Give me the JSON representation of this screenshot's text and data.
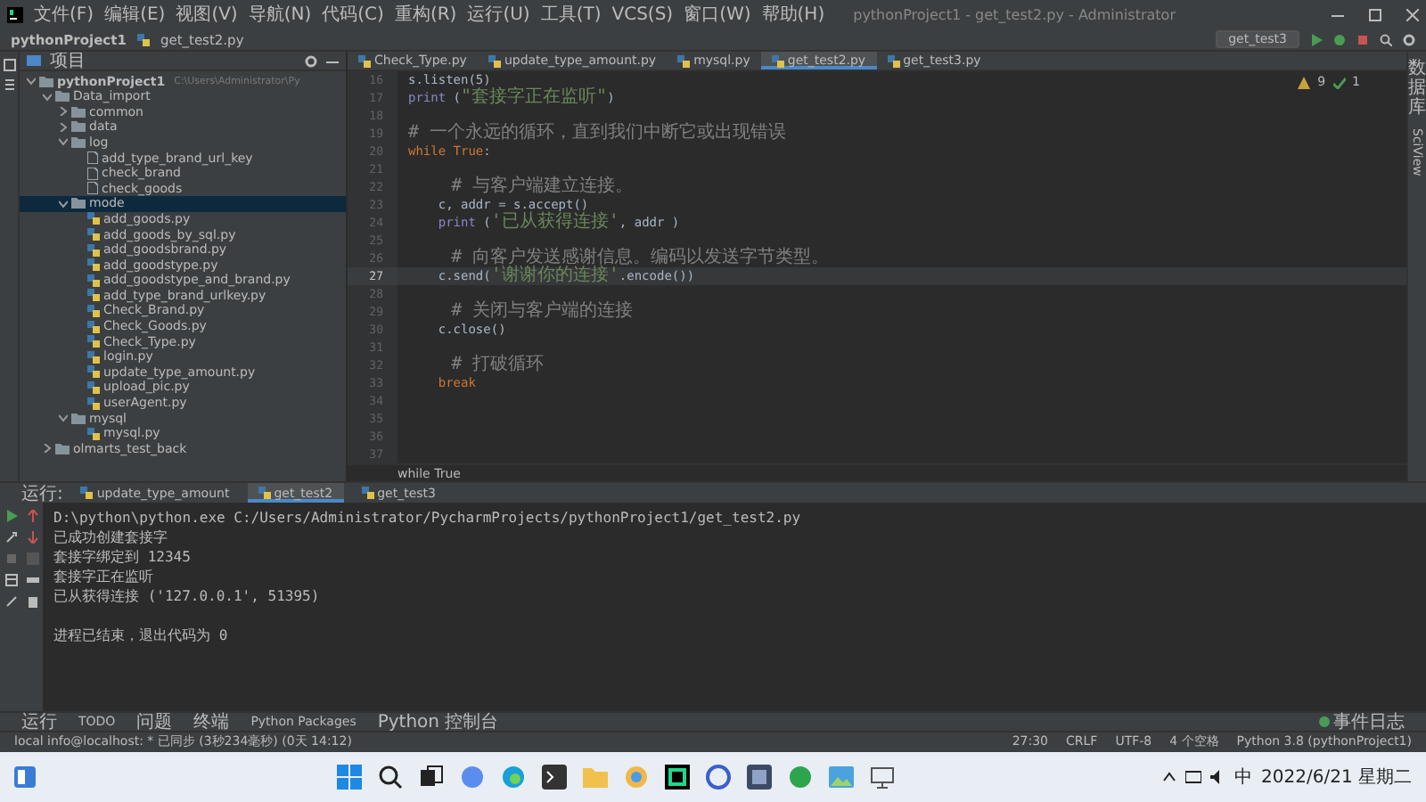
{
  "title_bar": {
    "menus": [
      "文件(F)",
      "编辑(E)",
      "视图(V)",
      "导航(N)",
      "代码(C)",
      "重构(R)",
      "运行(U)",
      "工具(T)",
      "VCS(S)",
      "窗口(W)",
      "帮助(H)"
    ],
    "title": "pythonProject1 - get_test2.py - Administrator"
  },
  "nav_bar": {
    "breadcrumbs": [
      "pythonProject1",
      "get_test2.py"
    ],
    "run_config": "get_test3"
  },
  "project_panel": {
    "title": "项目",
    "tree": [
      {
        "name": "pythonProject1",
        "hint": "C:\\Users\\Administrator\\Py",
        "kind": "root",
        "expanded": true,
        "selected": false,
        "children": [
          {
            "name": "Data_import",
            "kind": "folder",
            "expanded": true,
            "selected": false,
            "children": [
              {
                "name": "common",
                "kind": "folder",
                "expanded": false,
                "selected": false
              },
              {
                "name": "data",
                "kind": "folder",
                "expanded": false,
                "selected": false
              },
              {
                "name": "log",
                "kind": "folder",
                "expanded": true,
                "selected": false,
                "children": [
                  {
                    "name": "add_type_brand_url_key",
                    "kind": "file",
                    "selected": false
                  },
                  {
                    "name": "check_brand",
                    "kind": "file",
                    "selected": false
                  },
                  {
                    "name": "check_goods",
                    "kind": "file",
                    "selected": false
                  }
                ]
              },
              {
                "name": "mode",
                "kind": "folder",
                "expanded": true,
                "selected": true,
                "children": [
                  {
                    "name": "add_goods.py",
                    "kind": "py",
                    "selected": false
                  },
                  {
                    "name": "add_goods_by_sql.py",
                    "kind": "py",
                    "selected": false
                  },
                  {
                    "name": "add_goodsbrand.py",
                    "kind": "py",
                    "selected": false
                  },
                  {
                    "name": "add_goodstype.py",
                    "kind": "py",
                    "selected": false
                  },
                  {
                    "name": "add_goodstype_and_brand.py",
                    "kind": "py",
                    "selected": false
                  },
                  {
                    "name": "add_type_brand_urlkey.py",
                    "kind": "py",
                    "selected": false
                  },
                  {
                    "name": "Check_Brand.py",
                    "kind": "py",
                    "selected": false
                  },
                  {
                    "name": "Check_Goods.py",
                    "kind": "py",
                    "selected": false
                  },
                  {
                    "name": "Check_Type.py",
                    "kind": "py",
                    "selected": false
                  },
                  {
                    "name": "login.py",
                    "kind": "py",
                    "selected": false
                  },
                  {
                    "name": "update_type_amount.py",
                    "kind": "py",
                    "selected": false
                  },
                  {
                    "name": "upload_pic.py",
                    "kind": "py",
                    "selected": false
                  },
                  {
                    "name": "userAgent.py",
                    "kind": "py",
                    "selected": false
                  }
                ]
              },
              {
                "name": "mysql",
                "kind": "folder",
                "expanded": true,
                "selected": false,
                "children": [
                  {
                    "name": "mysql.py",
                    "kind": "py",
                    "selected": false
                  }
                ]
              }
            ]
          },
          {
            "name": "olmarts_test_back",
            "kind": "folder",
            "expanded": false,
            "selected": false
          }
        ]
      }
    ]
  },
  "editor": {
    "tabs": [
      {
        "label": "Check_Type.py",
        "selected": false
      },
      {
        "label": "update_type_amount.py",
        "selected": false
      },
      {
        "label": "mysql.py",
        "selected": false
      },
      {
        "label": "get_test2.py",
        "selected": true
      },
      {
        "label": "get_test3.py",
        "selected": false
      }
    ],
    "inspections": {
      "warnings": "9",
      "passed": "1"
    },
    "lines": [
      {
        "number": "16",
        "current": false,
        "segments": [
          {
            "text": "s.listen(5)",
            "kind": "plain"
          }
        ]
      },
      {
        "number": "17",
        "current": false,
        "segments": [
          {
            "text": "print",
            "kind": "builtin"
          },
          {
            "text": " (",
            "kind": "plain"
          },
          {
            "text": "\"套接字正在监听\"",
            "kind": "string"
          },
          {
            "text": ")",
            "kind": "plain"
          }
        ]
      },
      {
        "number": "18",
        "current": false
      },
      {
        "number": "19",
        "current": false,
        "segments": [
          {
            "text": "# 一个永远的循环，直到我们中断它或出现错误",
            "kind": "comment"
          }
        ]
      },
      {
        "number": "20",
        "current": false,
        "segments": [
          {
            "text": "while True",
            "kind": "keyword"
          },
          {
            "text": ":",
            "kind": "plain"
          }
        ]
      },
      {
        "number": "21",
        "current": false
      },
      {
        "number": "22",
        "current": false,
        "segments": [
          {
            "text": "    # 与客户端建立连接。",
            "kind": "comment"
          }
        ]
      },
      {
        "number": "23",
        "current": false,
        "segments": [
          {
            "text": "    c, addr = s.accept()",
            "kind": "plain"
          }
        ]
      },
      {
        "number": "24",
        "current": false,
        "segments": [
          {
            "text": "    print",
            "kind": "builtin"
          },
          {
            "text": " (",
            "kind": "plain"
          },
          {
            "text": "'已从获得连接'",
            "kind": "string"
          },
          {
            "text": ", addr )",
            "kind": "plain"
          }
        ]
      },
      {
        "number": "25",
        "current": false
      },
      {
        "number": "26",
        "current": false,
        "segments": [
          {
            "text": "    # 向客户发送感谢信息。编码以发送字节类型。",
            "kind": "comment"
          }
        ]
      },
      {
        "number": "27",
        "current": true,
        "segments": [
          {
            "text": "    c.send(",
            "kind": "plain"
          },
          {
            "text": "'谢谢你的连接'",
            "kind": "string"
          },
          {
            "text": ".encode())",
            "kind": "plain"
          }
        ]
      },
      {
        "number": "28",
        "current": false
      },
      {
        "number": "29",
        "current": false,
        "segments": [
          {
            "text": "    # 关闭与客户端的连接",
            "kind": "comment"
          }
        ]
      },
      {
        "number": "30",
        "current": false,
        "segments": [
          {
            "text": "    c.close()",
            "kind": "plain"
          }
        ]
      },
      {
        "number": "31",
        "current": false
      },
      {
        "number": "32",
        "current": false,
        "segments": [
          {
            "text": "    # 打破循环",
            "kind": "comment"
          }
        ]
      },
      {
        "number": "33",
        "current": false,
        "segments": [
          {
            "text": "    break",
            "kind": "keyword"
          }
        ]
      },
      {
        "number": "34",
        "current": false
      },
      {
        "number": "35",
        "current": false
      },
      {
        "number": "36",
        "current": false
      },
      {
        "number": "37",
        "current": false
      }
    ],
    "breadcrumb": "while True"
  },
  "right_strip": [
    {
      "text": "数据库",
      "kind": "cjk"
    },
    {
      "text": "SciView",
      "kind": "latin"
    }
  ],
  "run_panel": {
    "label": "运行:",
    "tabs": [
      {
        "label": "update_type_amount",
        "selected": false
      },
      {
        "label": "get_test2",
        "selected": true
      },
      {
        "label": "get_test3",
        "selected": false
      }
    ],
    "output": [
      {
        "text": "D:\\python\\python.exe C:/Users/Administrator/PycharmProjects/pythonProject1/get_test2.py",
        "gap_before": false
      },
      {
        "text": "已成功创建套接字",
        "gap_before": false
      },
      {
        "text": "套接字绑定到 12345",
        "gap_before": false
      },
      {
        "text": "套接字正在监听",
        "gap_before": false
      },
      {
        "text": "已从获得连接 ('127.0.0.1', 51395)",
        "gap_before": false
      },
      {
        "text": "进程已结束，退出代码为 0",
        "gap_before": true
      }
    ]
  },
  "tool_bar": {
    "tabs": [
      "运行",
      "TODO",
      "问题",
      "终端",
      "Python Packages",
      "Python 控制台"
    ],
    "event_log": "事件日志"
  },
  "status_bar": {
    "message": "local info@localhost: * 已同步 (3秒234毫秒) (0天 14:12)",
    "items": [
      "27:30",
      "CRLF",
      "UTF-8",
      "4 个空格",
      "Python 3.8 (pythonProject1)"
    ]
  },
  "taskbar": {
    "ime": "中",
    "date": "2022/6/21 星期二"
  }
}
